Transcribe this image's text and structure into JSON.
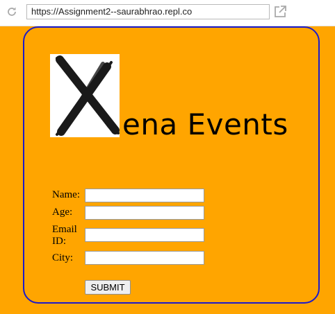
{
  "browser": {
    "url": "https://Assignment2--saurabhrao.repl.co"
  },
  "logo": {
    "initial": "X",
    "rest": "ena Events"
  },
  "form": {
    "name_label": "Name:",
    "age_label": "Age:",
    "email_label_line1": "Email",
    "email_label_line2": "ID:",
    "city_label": "City:",
    "name_value": "",
    "age_value": "",
    "email_value": "",
    "city_value": "",
    "submit_label": "SUBMIT"
  },
  "colors": {
    "page_background": "#FFA500",
    "card_border": "#1a1acc"
  }
}
